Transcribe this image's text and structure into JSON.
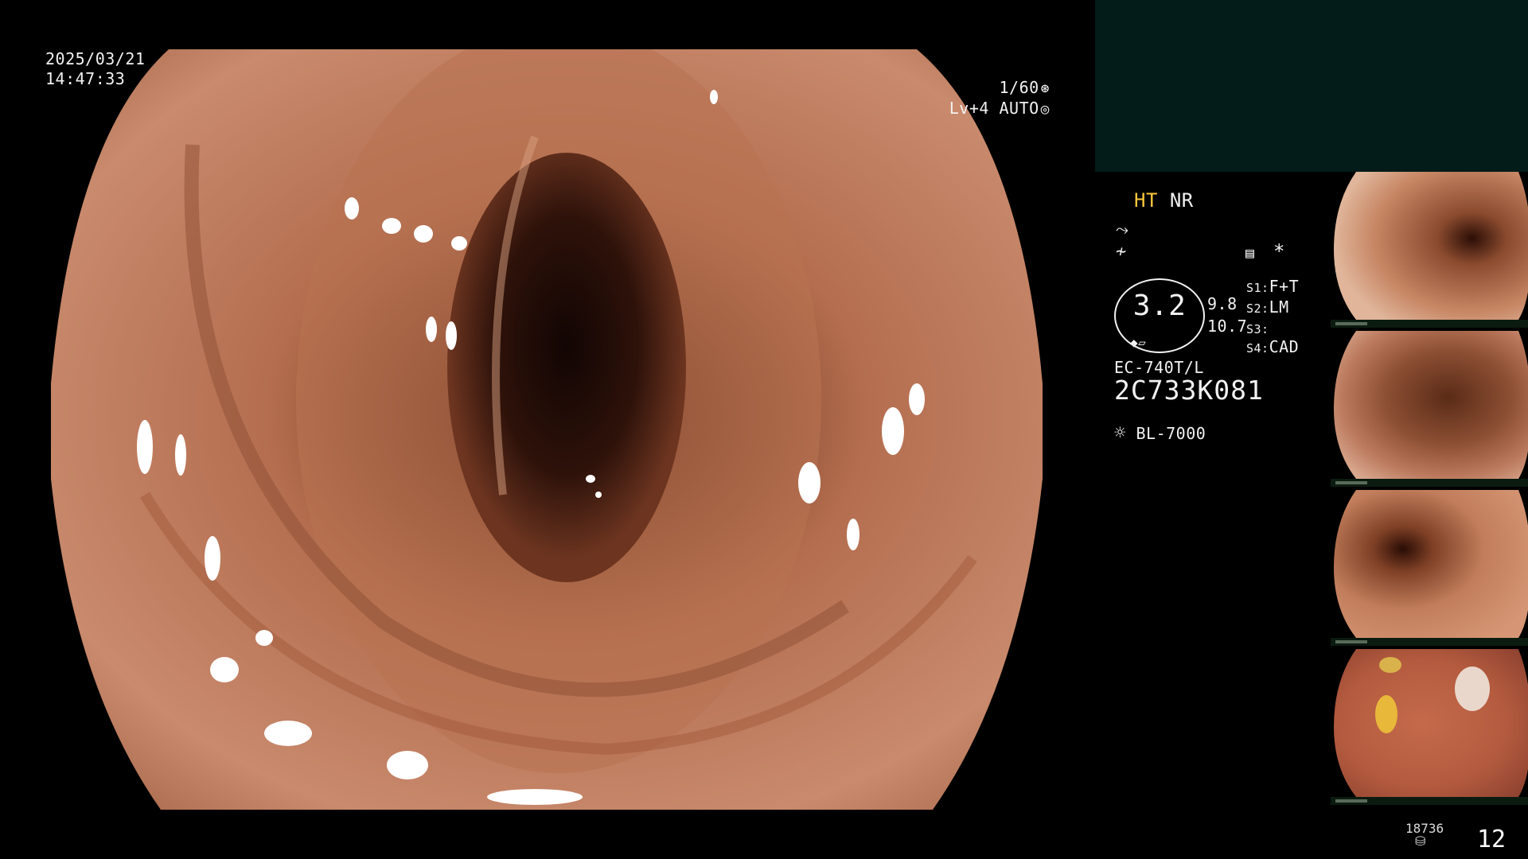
{
  "osd": {
    "date": "2025/03/21",
    "time": "14:47:33",
    "shutter": "1/60",
    "level": "Lv+4",
    "mode": "AUTO"
  },
  "panel": {
    "ht": "HT",
    "nr": "NR",
    "ring_value": "3.2",
    "side_top": "9.8",
    "side_bottom": "10.7",
    "s1_label": "S1:",
    "s1_value": "F+T",
    "s2_label": "S2:",
    "s2_value": "LM",
    "s3_label": "S3:",
    "s3_value": "",
    "s4_label": "S4:",
    "s4_value": "CAD",
    "asterisk": "*",
    "scope_model": "EC-740T/L",
    "scope_serial": "2C733K081",
    "light_source": "BL-7000"
  },
  "footer": {
    "image_count": "18736",
    "captures": "12"
  },
  "colors": {
    "accent_yellow": "#ffc83c",
    "sub_monitor": "#031b19"
  },
  "icons": [
    "aperture-icon",
    "iris-icon",
    "stroke-icon",
    "wave-icon",
    "memo-icon",
    "scope-tip-icon",
    "sun-icon",
    "storage-icon"
  ]
}
